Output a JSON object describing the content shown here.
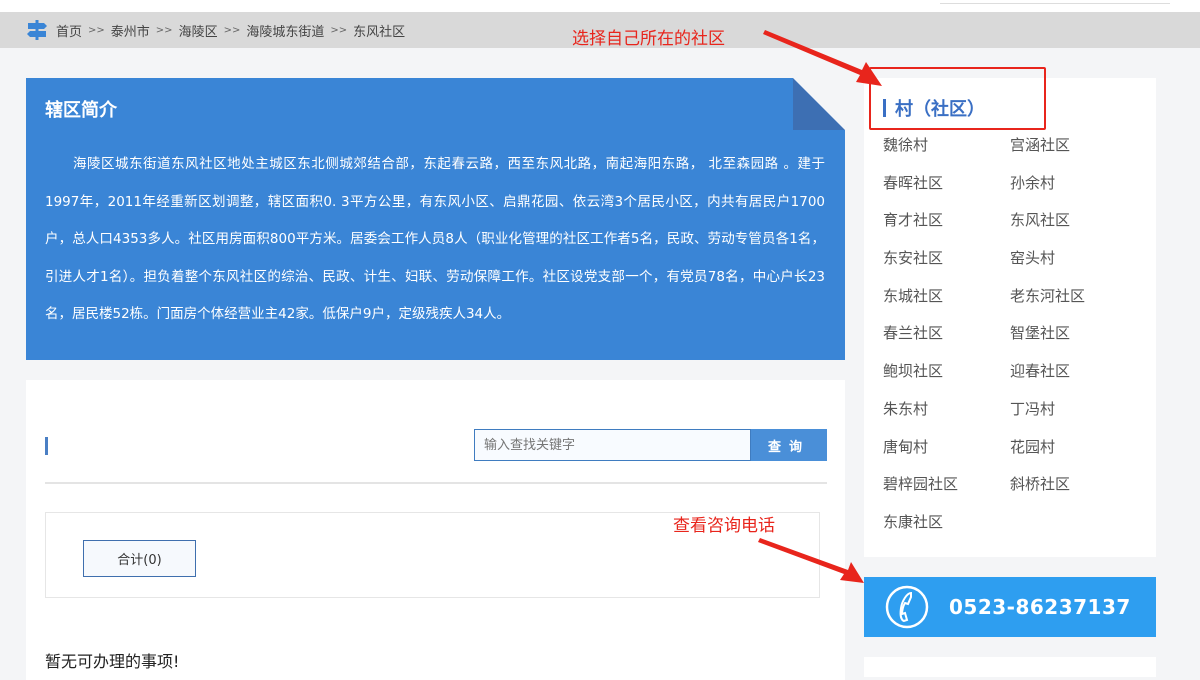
{
  "breadcrumb": [
    "首页",
    "泰州市",
    "海陵区",
    "海陵城东街道",
    "东风社区"
  ],
  "breadcrumb_separator": ">>",
  "intro": {
    "title": "辖区简介",
    "text": "海陵区城东街道东风社区地处主城区东北侧城郊结合部，东起春云路，西至东风北路，南起海阳东路， 北至森园路 。建于1997年，2011年经重新区划调整，辖区面积0. 3平方公里，有东风小区、启鼎花园、依云湾3个居民小区，内共有居民户1700户，总人口4353多人。社区用房面积800平方米。居委会工作人员8人（职业化管理的社区工作者5名，民政、劳动专管员各1名，引进人才1名）。担负着整个东风社区的综治、民政、计生、妇联、劳动保障工作。社区设党支部一个，有党员78名，中心户长23名，居民楼52栋。门面房个体经营业主42家。低保户9户，定级残疾人34人。"
  },
  "search": {
    "placeholder": "输入查找关键字",
    "button": "查询"
  },
  "count_label": "合计(0)",
  "empty_message": "暂无可办理的事项!",
  "sidebar": {
    "title": "村（社区）",
    "items": [
      "魏徐村",
      "宫涵社区",
      "春晖社区",
      "孙余村",
      "育才社区",
      "东风社区",
      "东安社区",
      "窑头村",
      "东城社区",
      "老东河社区",
      "春兰社区",
      "智堡社区",
      "鲍坝社区",
      "迎春社区",
      "朱东村",
      "丁冯村",
      "唐甸村",
      "花园村",
      "碧梓园社区",
      "斜桥社区",
      "东康社区"
    ]
  },
  "phone": "0523-86237137",
  "annotations": {
    "select_community": "选择自己所在的社区",
    "view_phone": "查看咨询电话"
  },
  "colors": {
    "primary": "#3a85d6",
    "phone_bg": "#2e9ef0",
    "annotation": "#e8251c"
  }
}
